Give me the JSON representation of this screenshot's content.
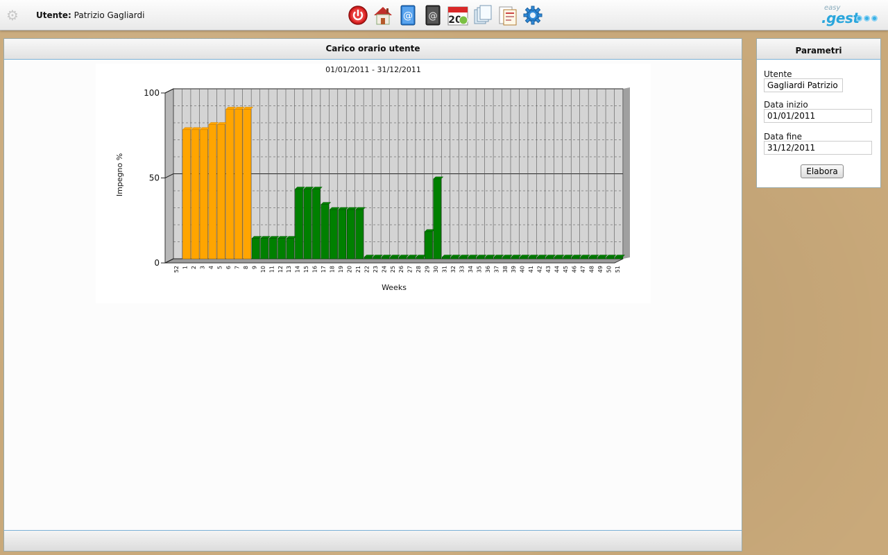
{
  "header": {
    "user_label": "Utente:",
    "user_name": "Patrizio Gagliardi",
    "toolbar_icons": [
      "power-icon",
      "home-icon",
      "address-book-icon",
      "email-book-icon",
      "calendar-icon",
      "documents-icon",
      "report-icon",
      "settings-gear-icon"
    ],
    "logo_easy": "easy",
    "logo_gest": ".gest"
  },
  "main": {
    "title": "Carico orario utente"
  },
  "chart_data": {
    "type": "bar",
    "title": "01/01/2011 - 31/12/2011",
    "xlabel": "Weeks",
    "ylabel": "Impegno %",
    "ylim": [
      0,
      100
    ],
    "yticks": [
      "100",
      "50",
      "0"
    ],
    "grid": true,
    "categories": [
      "52",
      "1",
      "2",
      "3",
      "4",
      "5",
      "6",
      "7",
      "8",
      "9",
      "10",
      "11",
      "12",
      "13",
      "14",
      "15",
      "16",
      "17",
      "18",
      "19",
      "20",
      "21",
      "22",
      "23",
      "24",
      "25",
      "26",
      "27",
      "28",
      "29",
      "30",
      "31",
      "32",
      "33",
      "34",
      "35",
      "36",
      "37",
      "38",
      "39",
      "40",
      "41",
      "42",
      "43",
      "44",
      "45",
      "46",
      "47",
      "48",
      "49",
      "50",
      "51"
    ],
    "values": [
      0,
      76,
      76,
      76,
      79,
      79,
      88,
      88,
      88,
      12,
      12,
      12,
      12,
      12,
      41,
      41,
      41,
      32,
      29,
      29,
      29,
      29,
      1,
      1,
      1,
      1,
      1,
      1,
      1,
      16,
      47,
      1,
      1,
      1,
      1,
      1,
      1,
      1,
      1,
      1,
      1,
      1,
      1,
      1,
      1,
      1,
      1,
      1,
      1,
      1,
      1,
      1
    ],
    "colors": {
      "high": "#ffa500",
      "normal": "#008000"
    },
    "high_threshold_weeks": [
      "1",
      "2",
      "3",
      "4",
      "5",
      "6",
      "7",
      "8"
    ]
  },
  "side": {
    "title": "Parametri",
    "utente_label": "Utente",
    "utente_value": "Gagliardi Patrizio",
    "data_inizio_label": "Data inizio",
    "data_inizio_value": "01/01/2011",
    "data_fine_label": "Data fine",
    "data_fine_value": "31/12/2011",
    "elabora_label": "Elabora"
  }
}
